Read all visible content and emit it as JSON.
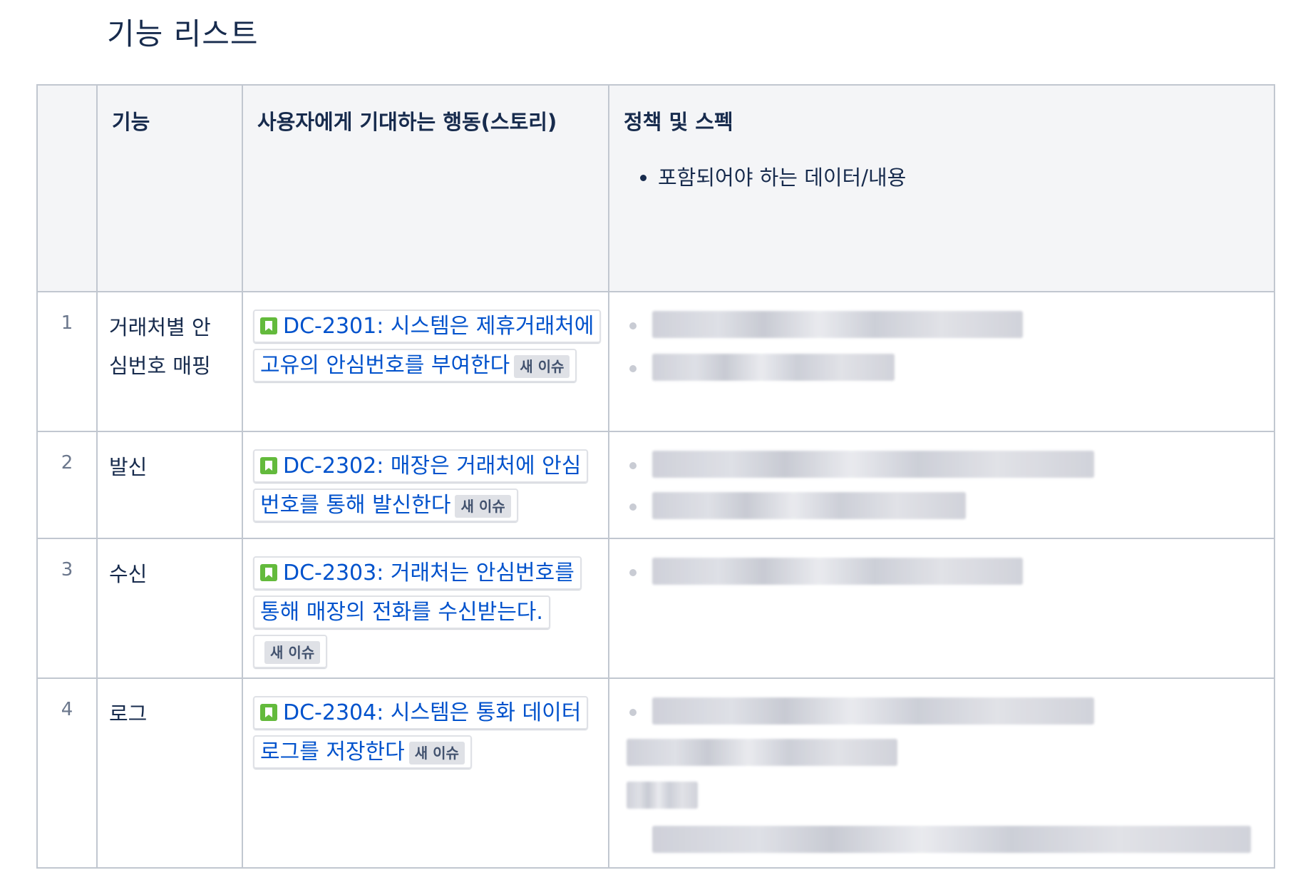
{
  "title": "기능 리스트",
  "table": {
    "headers": {
      "num": "",
      "feature": "기능",
      "story": "사용자에게 기대하는 행동(스토리)",
      "spec": "정책 및 스펙",
      "spec_bullet": "포함되어야 하는 데이터/내용"
    },
    "rows": [
      {
        "num": "1",
        "feature": "거래처별 안\n심번호 매핑",
        "issue": "DC-2301: 시스템은 제휴거래처에 고유의 안심번호를 부여한다",
        "badge": "새 이슈"
      },
      {
        "num": "2",
        "feature": "발신",
        "issue": "DC-2302: 매장은 거래처에 안심번호를 통해 발신한다",
        "badge": "새 이슈"
      },
      {
        "num": "3",
        "feature": "수신",
        "issue": "DC-2303: 거래처는 안심번호를 통해 매장의 전화를 수신받는다.",
        "badge": "새 이슈"
      },
      {
        "num": "4",
        "feature": "로그",
        "issue": "DC-2304: 시스템은 통화 데이터 로그를 저장한다",
        "badge": "새 이슈"
      }
    ]
  },
  "icons": {
    "story": "story-icon"
  },
  "colors": {
    "link": "#0052cc",
    "story_icon": "#63ba3c",
    "header_bg": "#f4f5f7"
  }
}
